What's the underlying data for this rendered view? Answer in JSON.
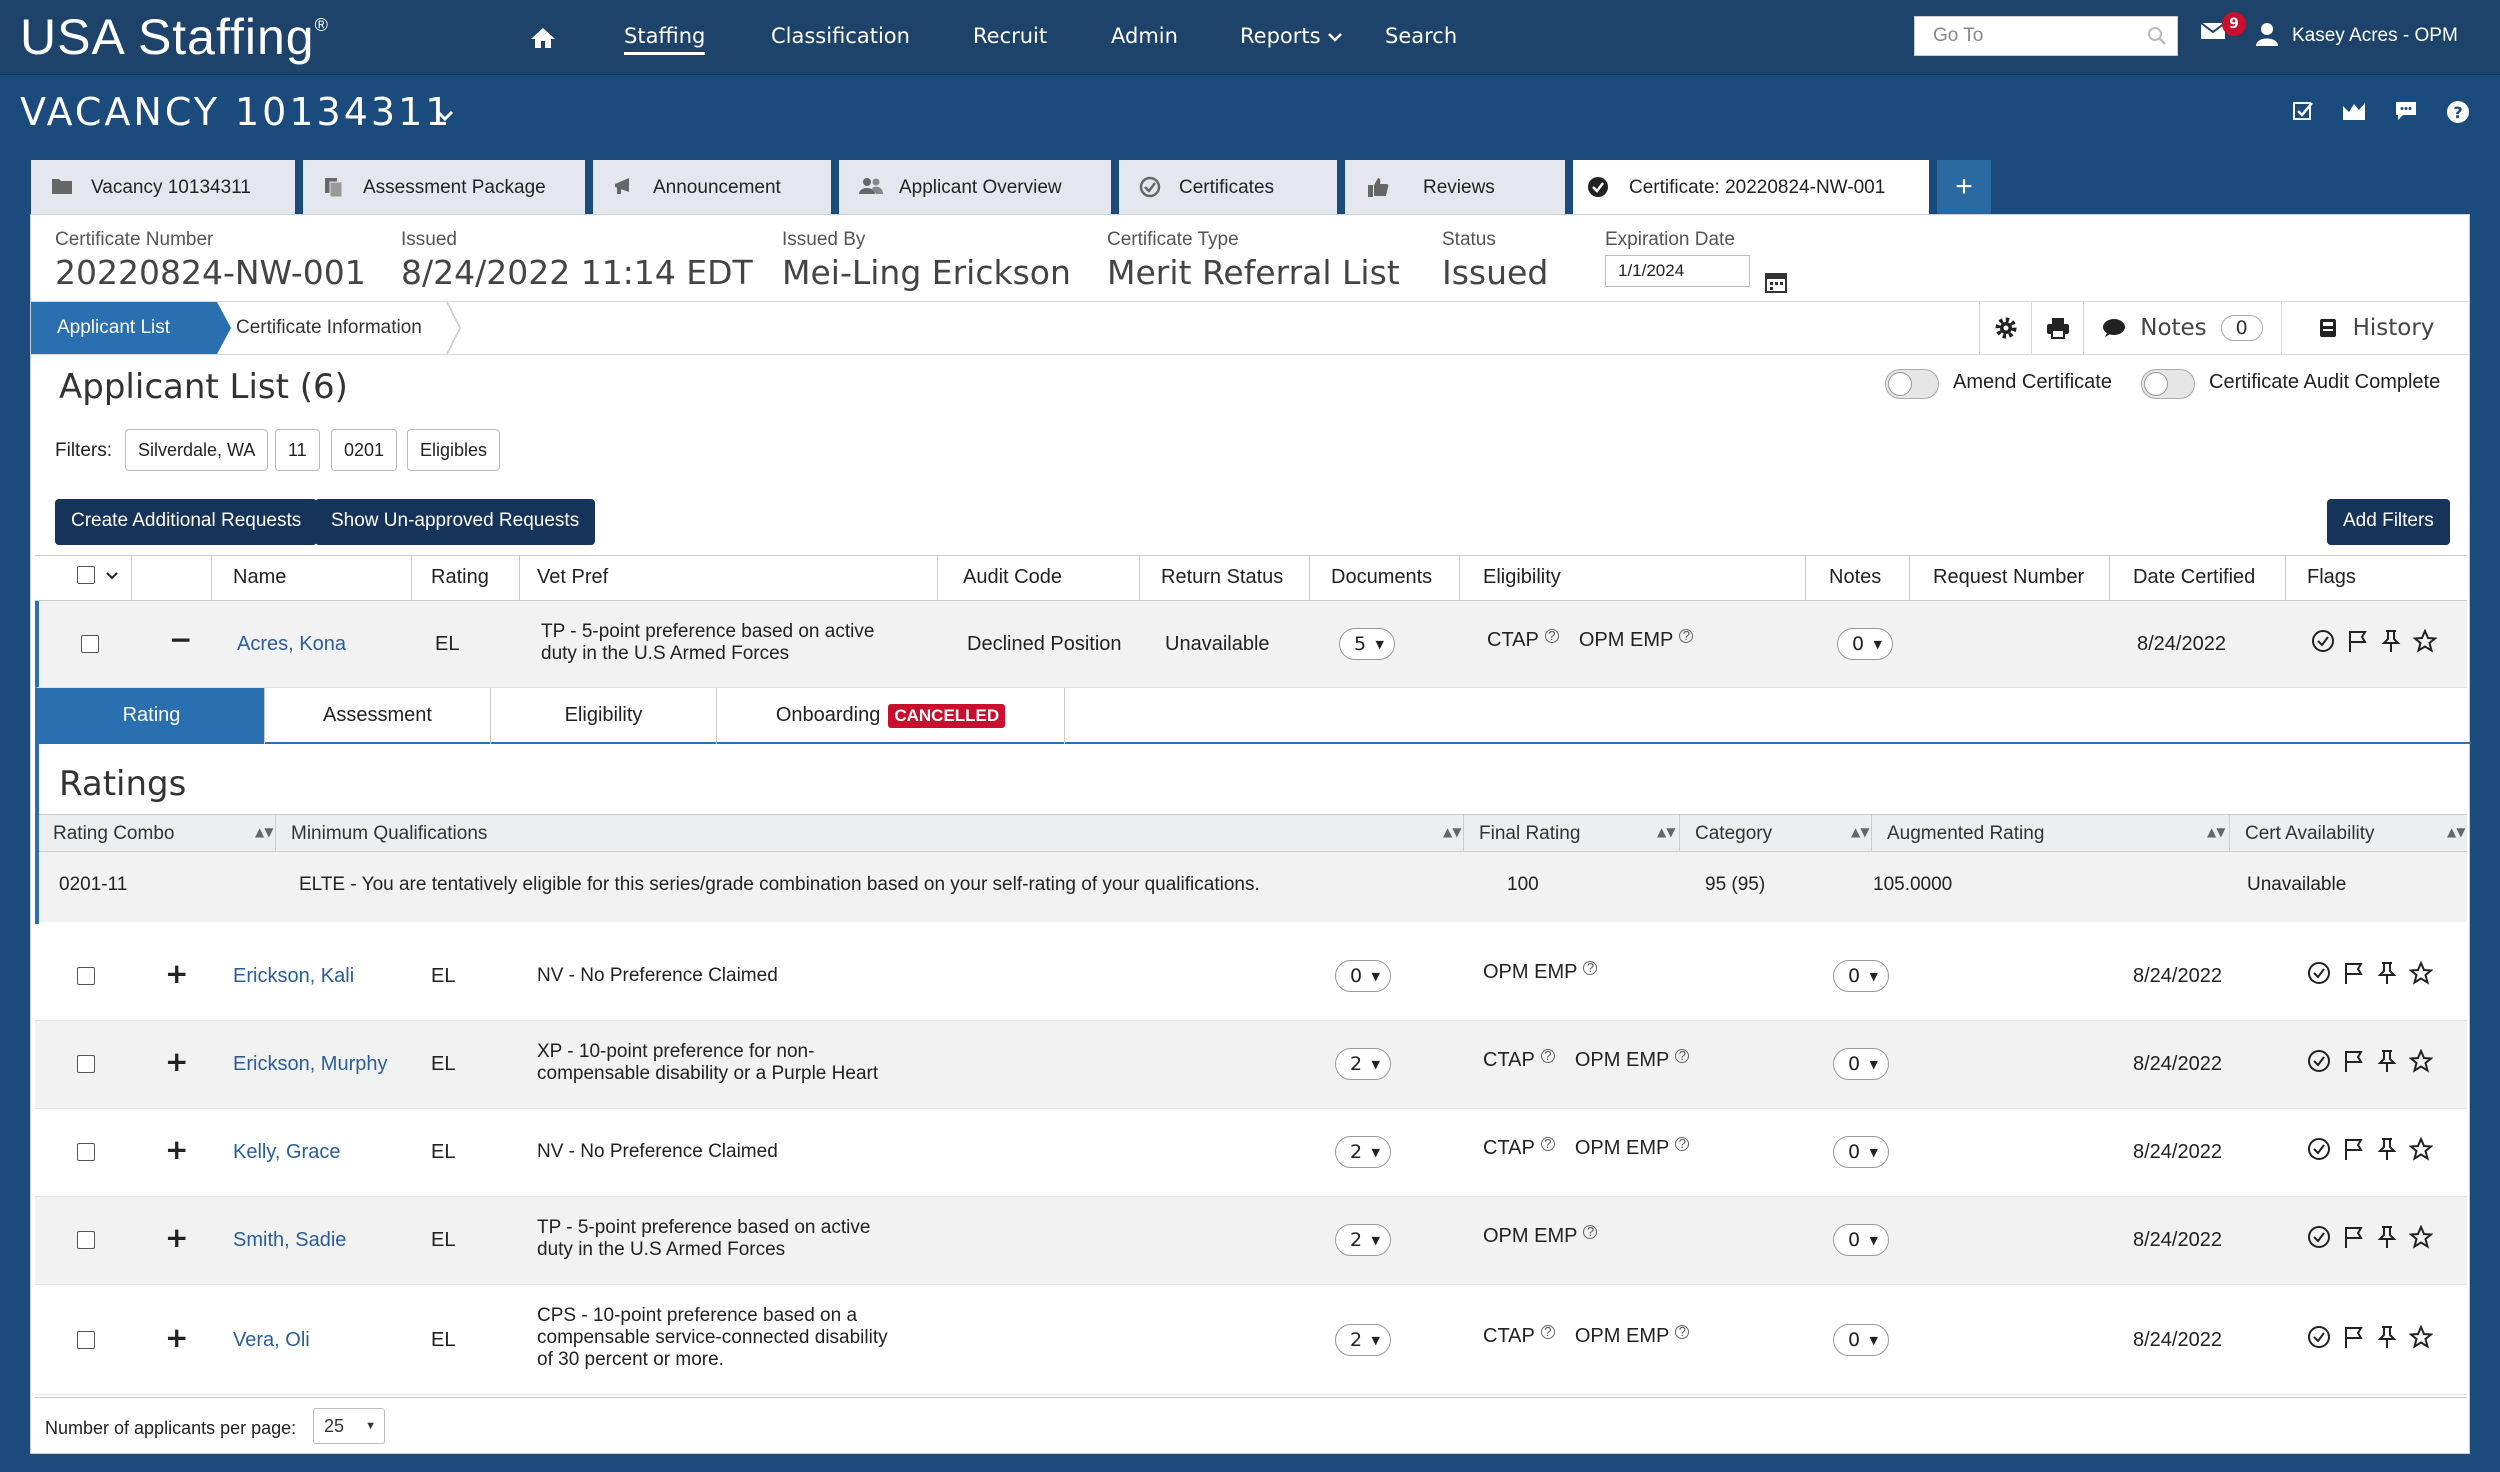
{
  "app": {
    "title": "USA Staffing",
    "reg": "®"
  },
  "nav": {
    "items": [
      "Staffing",
      "Classification",
      "Recruit",
      "Admin",
      "Reports",
      "Search"
    ]
  },
  "goto": {
    "placeholder": "Go To"
  },
  "notifications": {
    "count": "9"
  },
  "user": {
    "name": "Kasey Acres - OPM"
  },
  "vacancy": {
    "title": "VACANCY 10134311"
  },
  "tabs": [
    "Vacancy 10134311",
    "Assessment Package",
    "Announcement",
    "Applicant Overview",
    "Certificates",
    "Reviews",
    "Certificate: 20220824-NW-001"
  ],
  "tab_add": "+",
  "certificate": {
    "number_label": "Certificate Number",
    "number": "20220824-NW-001",
    "issued_label": "Issued",
    "issued": "8/24/2022 11:14 EDT",
    "issued_by_label": "Issued By",
    "issued_by": "Mei-Ling Erickson",
    "type_label": "Certificate Type",
    "type": "Merit Referral List",
    "status_label": "Status",
    "status": "Issued",
    "expiration_label": "Expiration Date",
    "expiration": "1/1/2024"
  },
  "breadcrumbs": {
    "active": "Applicant List",
    "next": "Certificate Information"
  },
  "toolbar": {
    "notes_label": "Notes",
    "notes_count": "0",
    "history_label": "History"
  },
  "applicant_list": {
    "title": "Applicant List (6)",
    "amend_label": "Amend Certificate",
    "audit_label": "Certificate Audit Complete",
    "filters_label": "Filters:",
    "filters": [
      "Silverdale, WA",
      "11",
      "0201",
      "Eligibles"
    ],
    "create_btn": "Create Additional Requests",
    "unapproved_btn": "Show Un-approved Requests",
    "add_filters_btn": "Add Filters"
  },
  "columns": [
    "Name",
    "Rating",
    "Vet Pref",
    "Audit Code",
    "Return Status",
    "Documents",
    "Eligibility",
    "Notes",
    "Request Number",
    "Date Certified",
    "Flags"
  ],
  "rows": [
    {
      "sign": "−",
      "name": "Acres, Kona",
      "rating": "EL",
      "vet_pref": "TP - 5-point preference based on active\nduty in the U.S Armed Forces",
      "audit": "Declined Position",
      "return_status": "Unavailable",
      "docs": "5",
      "elig": [
        "CTAP",
        "OPM EMP"
      ],
      "notes": "0",
      "date": "8/24/2022"
    },
    {
      "sign": "+",
      "name": "Erickson, Kali",
      "rating": "EL",
      "vet_pref": "NV - No Preference Claimed",
      "audit": "",
      "return_status": "",
      "docs": "0",
      "elig": [
        "OPM EMP"
      ],
      "notes": "0",
      "date": "8/24/2022"
    },
    {
      "sign": "+",
      "name": "Erickson, Murphy",
      "rating": "EL",
      "vet_pref": "XP - 10-point preference for non-\ncompensable disability or a Purple Heart",
      "audit": "",
      "return_status": "",
      "docs": "2",
      "elig": [
        "CTAP",
        "OPM EMP"
      ],
      "notes": "0",
      "date": "8/24/2022"
    },
    {
      "sign": "+",
      "name": "Kelly, Grace",
      "rating": "EL",
      "vet_pref": "NV - No Preference Claimed",
      "audit": "",
      "return_status": "",
      "docs": "2",
      "elig": [
        "CTAP",
        "OPM EMP"
      ],
      "notes": "0",
      "date": "8/24/2022"
    },
    {
      "sign": "+",
      "name": "Smith, Sadie",
      "rating": "EL",
      "vet_pref": "TP - 5-point preference based on active\nduty in the U.S Armed Forces",
      "audit": "",
      "return_status": "",
      "docs": "2",
      "elig": [
        "OPM EMP"
      ],
      "notes": "0",
      "date": "8/24/2022"
    },
    {
      "sign": "+",
      "name": "Vera, Oli",
      "rating": "EL",
      "vet_pref": "CPS - 10-point preference based on a\ncompensable service-connected disability\nof 30 percent or more.",
      "audit": "",
      "return_status": "",
      "docs": "2",
      "elig": [
        "CTAP",
        "OPM EMP"
      ],
      "notes": "0",
      "date": "8/24/2022"
    }
  ],
  "detail": {
    "tabs": [
      "Rating",
      "Assessment",
      "Eligibility",
      "Onboarding"
    ],
    "cancelled_badge": "CANCELLED",
    "ratings_title": "Ratings",
    "rating_columns": [
      "Rating Combo",
      "Minimum Qualifications",
      "Final Rating",
      "Category",
      "Augmented Rating",
      "Cert Availability"
    ],
    "rating_row": {
      "combo": "0201-11",
      "min_qual": "ELTE - You are tentatively eligible for this series/grade combination based on your self-rating of your qualifications.",
      "final": "100",
      "category": "95 (95)",
      "augmented": "105.0000",
      "availability": "Unavailable"
    }
  },
  "footer": {
    "per_page_label": "Number of applicants per page:",
    "per_page": "25"
  },
  "colors": {
    "nav_bg": "#1e436b",
    "page_bg": "#1b4a7d",
    "accent": "#2a6fb0",
    "danger": "#c8102e"
  }
}
